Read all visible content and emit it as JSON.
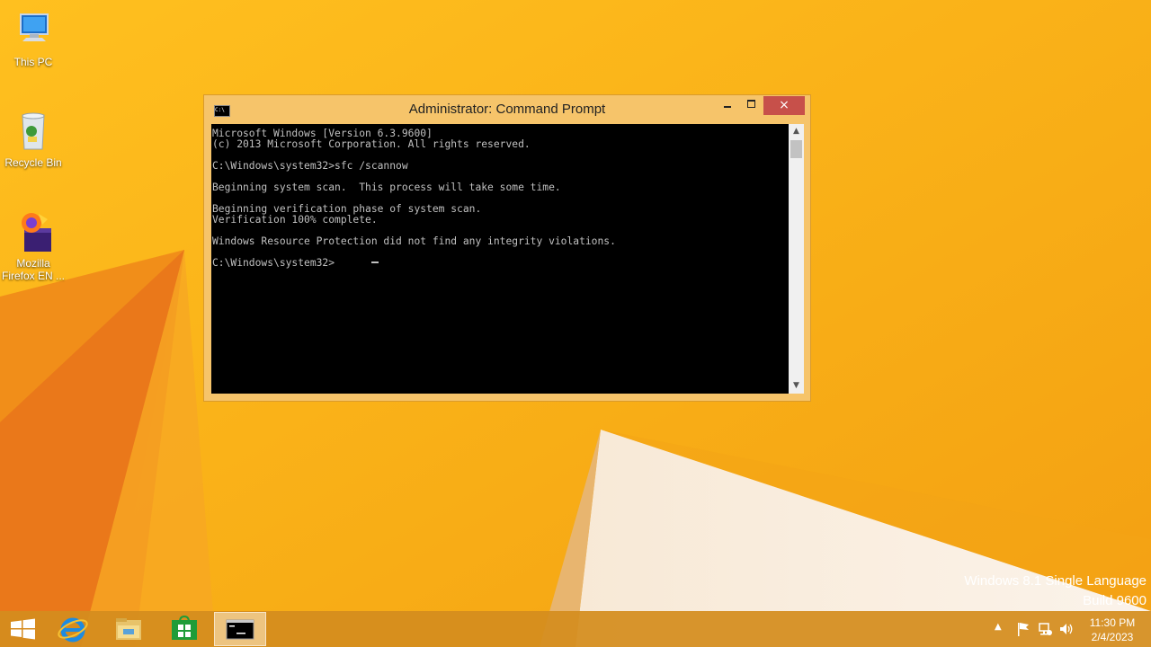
{
  "desktop": {
    "icons": [
      {
        "label": "This PC",
        "icon": "computer-icon"
      },
      {
        "label": "Recycle Bin",
        "icon": "recycle-bin-icon"
      },
      {
        "label": "Mozilla Firefox EN ...",
        "icon": "installer-icon"
      }
    ],
    "watermark": {
      "line1": "Windows 8.1 Single Language",
      "line2": "Build 9600"
    }
  },
  "window": {
    "title": "Administrator: Command Prompt",
    "controls": {
      "minimize": "minimize-icon",
      "maximize": "maximize-icon",
      "close": "×"
    },
    "console": {
      "text": "Microsoft Windows [Version 6.3.9600]\n(c) 2013 Microsoft Corporation. All rights reserved.\n\nC:\\Windows\\system32>sfc /scannow\n\nBeginning system scan.  This process will take some time.\n\nBeginning verification phase of system scan.\nVerification 100% complete.\n\nWindows Resource Protection did not find any integrity violations.\n\nC:\\Windows\\system32>"
    },
    "scrollbar": {
      "up": "▲",
      "down": "▼"
    }
  },
  "taskbar": {
    "items": [
      "start-icon",
      "internet-explorer-icon",
      "file-explorer-icon",
      "store-icon",
      "command-prompt-icon"
    ],
    "tray": {
      "expand": "▲",
      "icons": [
        "flag-icon",
        "network-icon",
        "volume-icon"
      ]
    },
    "clock": {
      "time": "11:30 PM",
      "date": "2/4/2023"
    }
  },
  "colors": {
    "accent": "#f7b21a",
    "close": "#c7504a",
    "taskbar": "#d48d1e"
  }
}
